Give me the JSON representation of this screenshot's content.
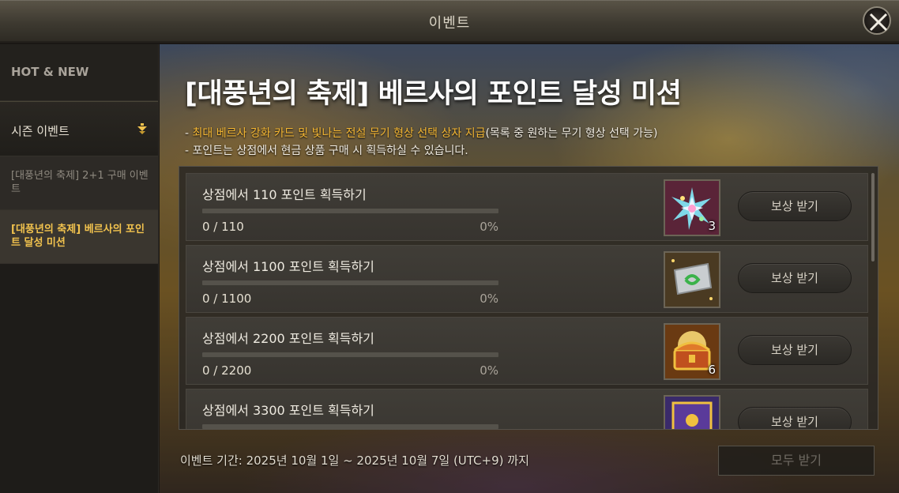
{
  "window": {
    "title": "이벤트"
  },
  "sidebar": {
    "hot_new": "HOT & NEW",
    "season": "시즌 이벤트",
    "subitems": [
      "[대풍년의 축제] 2+1 구매 이벤트",
      "[대풍년의 축제] 베르사의 포인트 달성 미션"
    ]
  },
  "event": {
    "title": "[대풍년의 축제] 베르사의 포인트 달성 미션",
    "desc1_prefix": "- ",
    "desc1_highlight": "최대 베르사 강화 카드 및 빛나는 전설 무기 형상 선택 상자 지급",
    "desc1_suffix": "(목록 중 원하는 무기 형상 선택 가능)",
    "desc2": "- 포인트는 상점에서 현금 상품 구매 시 획득하실 수 있습니다."
  },
  "missions": [
    {
      "label": "상점에서 110 포인트 획득하기",
      "count": "0 / 110",
      "percent": "0%",
      "progress": 0,
      "item_icon": "crystal-shard-icon",
      "qty": "3",
      "button": "보상 받기"
    },
    {
      "label": "상점에서 1100 포인트 획득하기",
      "count": "0 / 1100",
      "percent": "0%",
      "progress": 0,
      "item_icon": "enhance-card-icon",
      "qty": "",
      "button": "보상 받기"
    },
    {
      "label": "상점에서 2200 포인트 획득하기",
      "count": "0 / 2200",
      "percent": "0%",
      "progress": 0,
      "item_icon": "treasure-chest-icon",
      "qty": "6",
      "button": "보상 받기"
    },
    {
      "label": "상점에서 3300 포인트 획득하기",
      "count": "",
      "percent": "",
      "progress": 0,
      "item_icon": "legendary-box-icon",
      "qty": "",
      "button": "보상 받기"
    }
  ],
  "footer": {
    "period": "이벤트 기간: 2025년 10월 1일 ~ 2025년 10월 7일 (UTC+9) 까지",
    "claim_all": "모두 받기"
  },
  "colors": {
    "accent": "#f2c34e",
    "highlight": "#f5b733",
    "progress_fill": "#d6a845"
  }
}
